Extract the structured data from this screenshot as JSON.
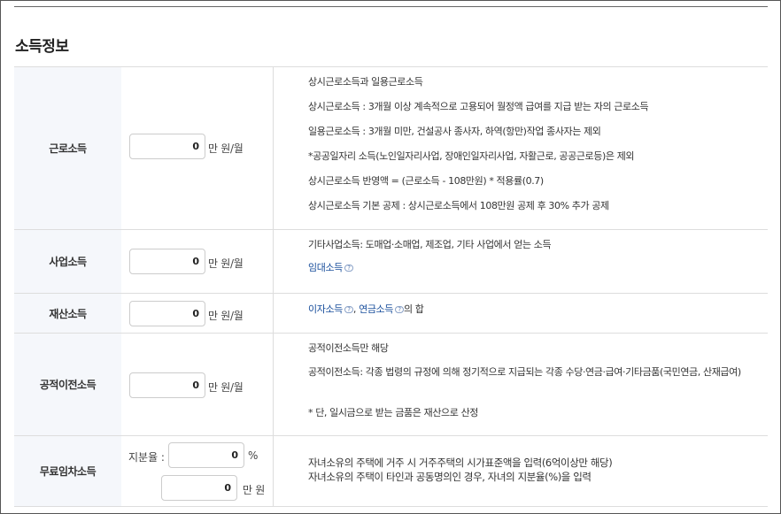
{
  "section_title": "소득정보",
  "rows": [
    {
      "label": "근로소득",
      "value": "0",
      "unit": "만 원/월",
      "desc": [
        "상시근로소득과 일용근로소득",
        "상시근로소득 : 3개월 이상 계속적으로 고용되어 월정액 급여를 지급 받는 자의 근로소득",
        "일용근로소득 : 3개월 미만, 건설공사 종사자, 하역(항만)작업 종사자는 제외",
        "*공공일자리 소득(노인일자리사업, 장애인일자리사업, 자활근로, 공공근로등)은 제외",
        "상시근로소득 반영액 = (근로소득 - 108만원) * 적용률(0.7)",
        "상시근로소득 기본 공제 : 상시근로소득에서 108만원 공제 후 30% 추가 공제"
      ]
    },
    {
      "label": "사업소득",
      "value": "0",
      "unit": "만 원/월",
      "desc": [
        "기타사업소득: 도매업·소매업, 제조업, 기타 사업에서 얻는 소득"
      ],
      "link": "임대소득"
    },
    {
      "label": "재산소득",
      "value": "0",
      "unit": "만 원/월",
      "link1": "이자소득",
      "sep": ", ",
      "link2": "연금소득",
      "suffix": "의 합"
    },
    {
      "label": "공적이전소득",
      "value": "0",
      "unit": "만 원/월",
      "desc": [
        "공적이전소득만 해당",
        "공적이전소득: 각종 법령의 규정에 의해 정기적으로 지급되는 각종 수당·연금·급여·기타금품(국민연금, 산재급여)",
        "* 단, 일시금으로 받는 금품은 재산으로 산정"
      ]
    },
    {
      "label": "무료임차소득",
      "ratio_label": "지분율 :",
      "ratio_value": "0",
      "ratio_unit": "%",
      "value": "0",
      "unit": "만 원",
      "desc": [
        "자녀소유의 주택에 거주 시 거주주택의 시가표준액을 입력(6억이상만 해당)",
        "자녀소유의 주택이 타인과 공동명의인 경우, 자녀의 지분율(%)을 입력"
      ]
    }
  ],
  "help_icon": "question-icon"
}
